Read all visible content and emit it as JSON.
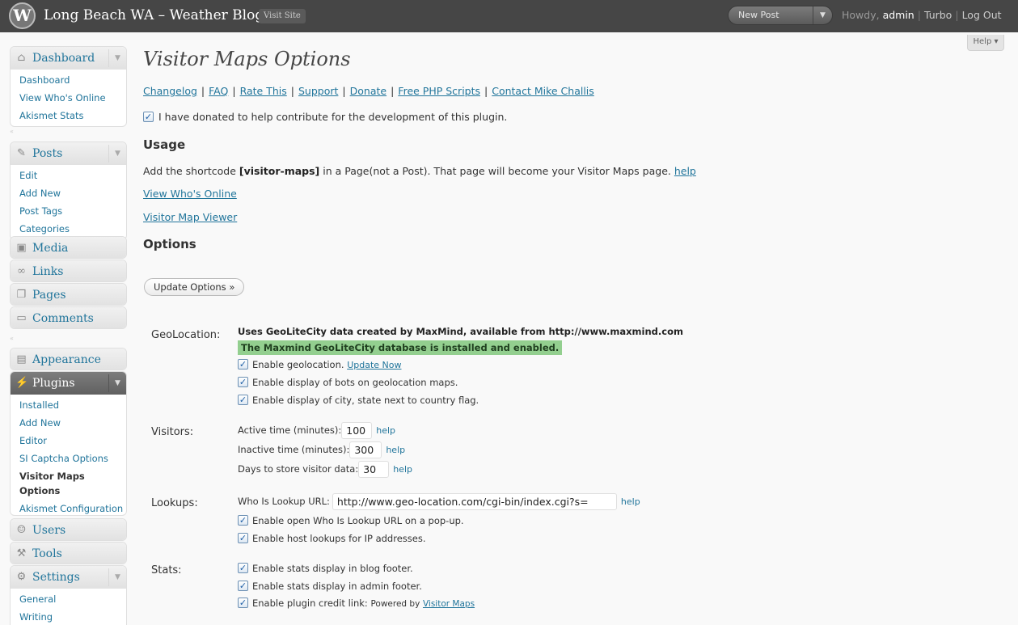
{
  "header": {
    "site_title": "Long Beach WA – Weather Blog",
    "visit_site": "Visit Site",
    "new_post": "New Post",
    "howdy": "Howdy,",
    "username": "admin",
    "turbo": "Turbo",
    "logout": "Log Out",
    "separator": "|"
  },
  "help_tab": "Help ▾",
  "sidebar": {
    "dashboard": {
      "label": "Dashboard",
      "items": [
        "Dashboard",
        "View Who's Online",
        "Akismet Stats"
      ]
    },
    "posts": {
      "label": "Posts",
      "items": [
        "Edit",
        "Add New",
        "Post Tags",
        "Categories"
      ]
    },
    "media": "Media",
    "links": "Links",
    "pages": "Pages",
    "comments": "Comments",
    "appearance": "Appearance",
    "plugins": {
      "label": "Plugins",
      "items": [
        "Installed",
        "Add New",
        "Editor",
        "SI Captcha Options",
        "Visitor Maps Options",
        "Akismet Configuration"
      ],
      "current": "Visitor Maps Options"
    },
    "users": "Users",
    "tools": "Tools",
    "settings": {
      "label": "Settings",
      "items": [
        "General",
        "Writing"
      ]
    }
  },
  "main": {
    "title": "Visitor Maps Options",
    "links": [
      "Changelog",
      "FAQ",
      "Rate This",
      "Support",
      "Donate",
      "Free PHP Scripts",
      "Contact Mike Challis"
    ],
    "donated_label": "I have donated to help contribute for the development of this plugin.",
    "usage_heading": "Usage",
    "usage_pre": "Add the shortcode ",
    "usage_shortcode": "[visitor-maps]",
    "usage_post": " in a Page(not a Post). That page will become your Visitor Maps page. ",
    "usage_help": "help",
    "view_whos_online": "View Who's Online",
    "visitor_map_viewer": "Visitor Map Viewer",
    "options_heading": "Options",
    "update_button": "Update Options »",
    "geolocation": {
      "label": "GeoLocation:",
      "credit": "Uses GeoLiteCity data created by MaxMind, available from http://www.maxmind.com",
      "installed": "The Maxmind GeoLiteCity database is installed and enabled.",
      "enable_geo": "Enable geolocation.",
      "update_now": "Update Now",
      "enable_bots": "Enable display of bots on geolocation maps.",
      "enable_city": "Enable display of city, state next to country flag."
    },
    "visitors": {
      "label": "Visitors:",
      "active_label": "Active time (minutes):",
      "active_value": "100",
      "inactive_label": "Inactive time (minutes):",
      "inactive_value": "300",
      "days_label": "Days to store visitor data:",
      "days_value": "30",
      "help": "help"
    },
    "lookups": {
      "label": "Lookups:",
      "url_label": "Who Is Lookup URL:",
      "url_value": "http://www.geo-location.com/cgi-bin/index.cgi?s=",
      "help": "help",
      "popup": "Enable open Who Is Lookup URL on a pop-up.",
      "host": "Enable host lookups for IP addresses."
    },
    "stats": {
      "label": "Stats:",
      "blog_footer": "Enable stats display in blog footer.",
      "admin_footer": "Enable stats display in admin footer.",
      "credit_link": "Enable plugin credit link:",
      "powered_by": "Powered by",
      "visitor_maps": "Visitor Maps"
    },
    "checkmark": "✓"
  }
}
